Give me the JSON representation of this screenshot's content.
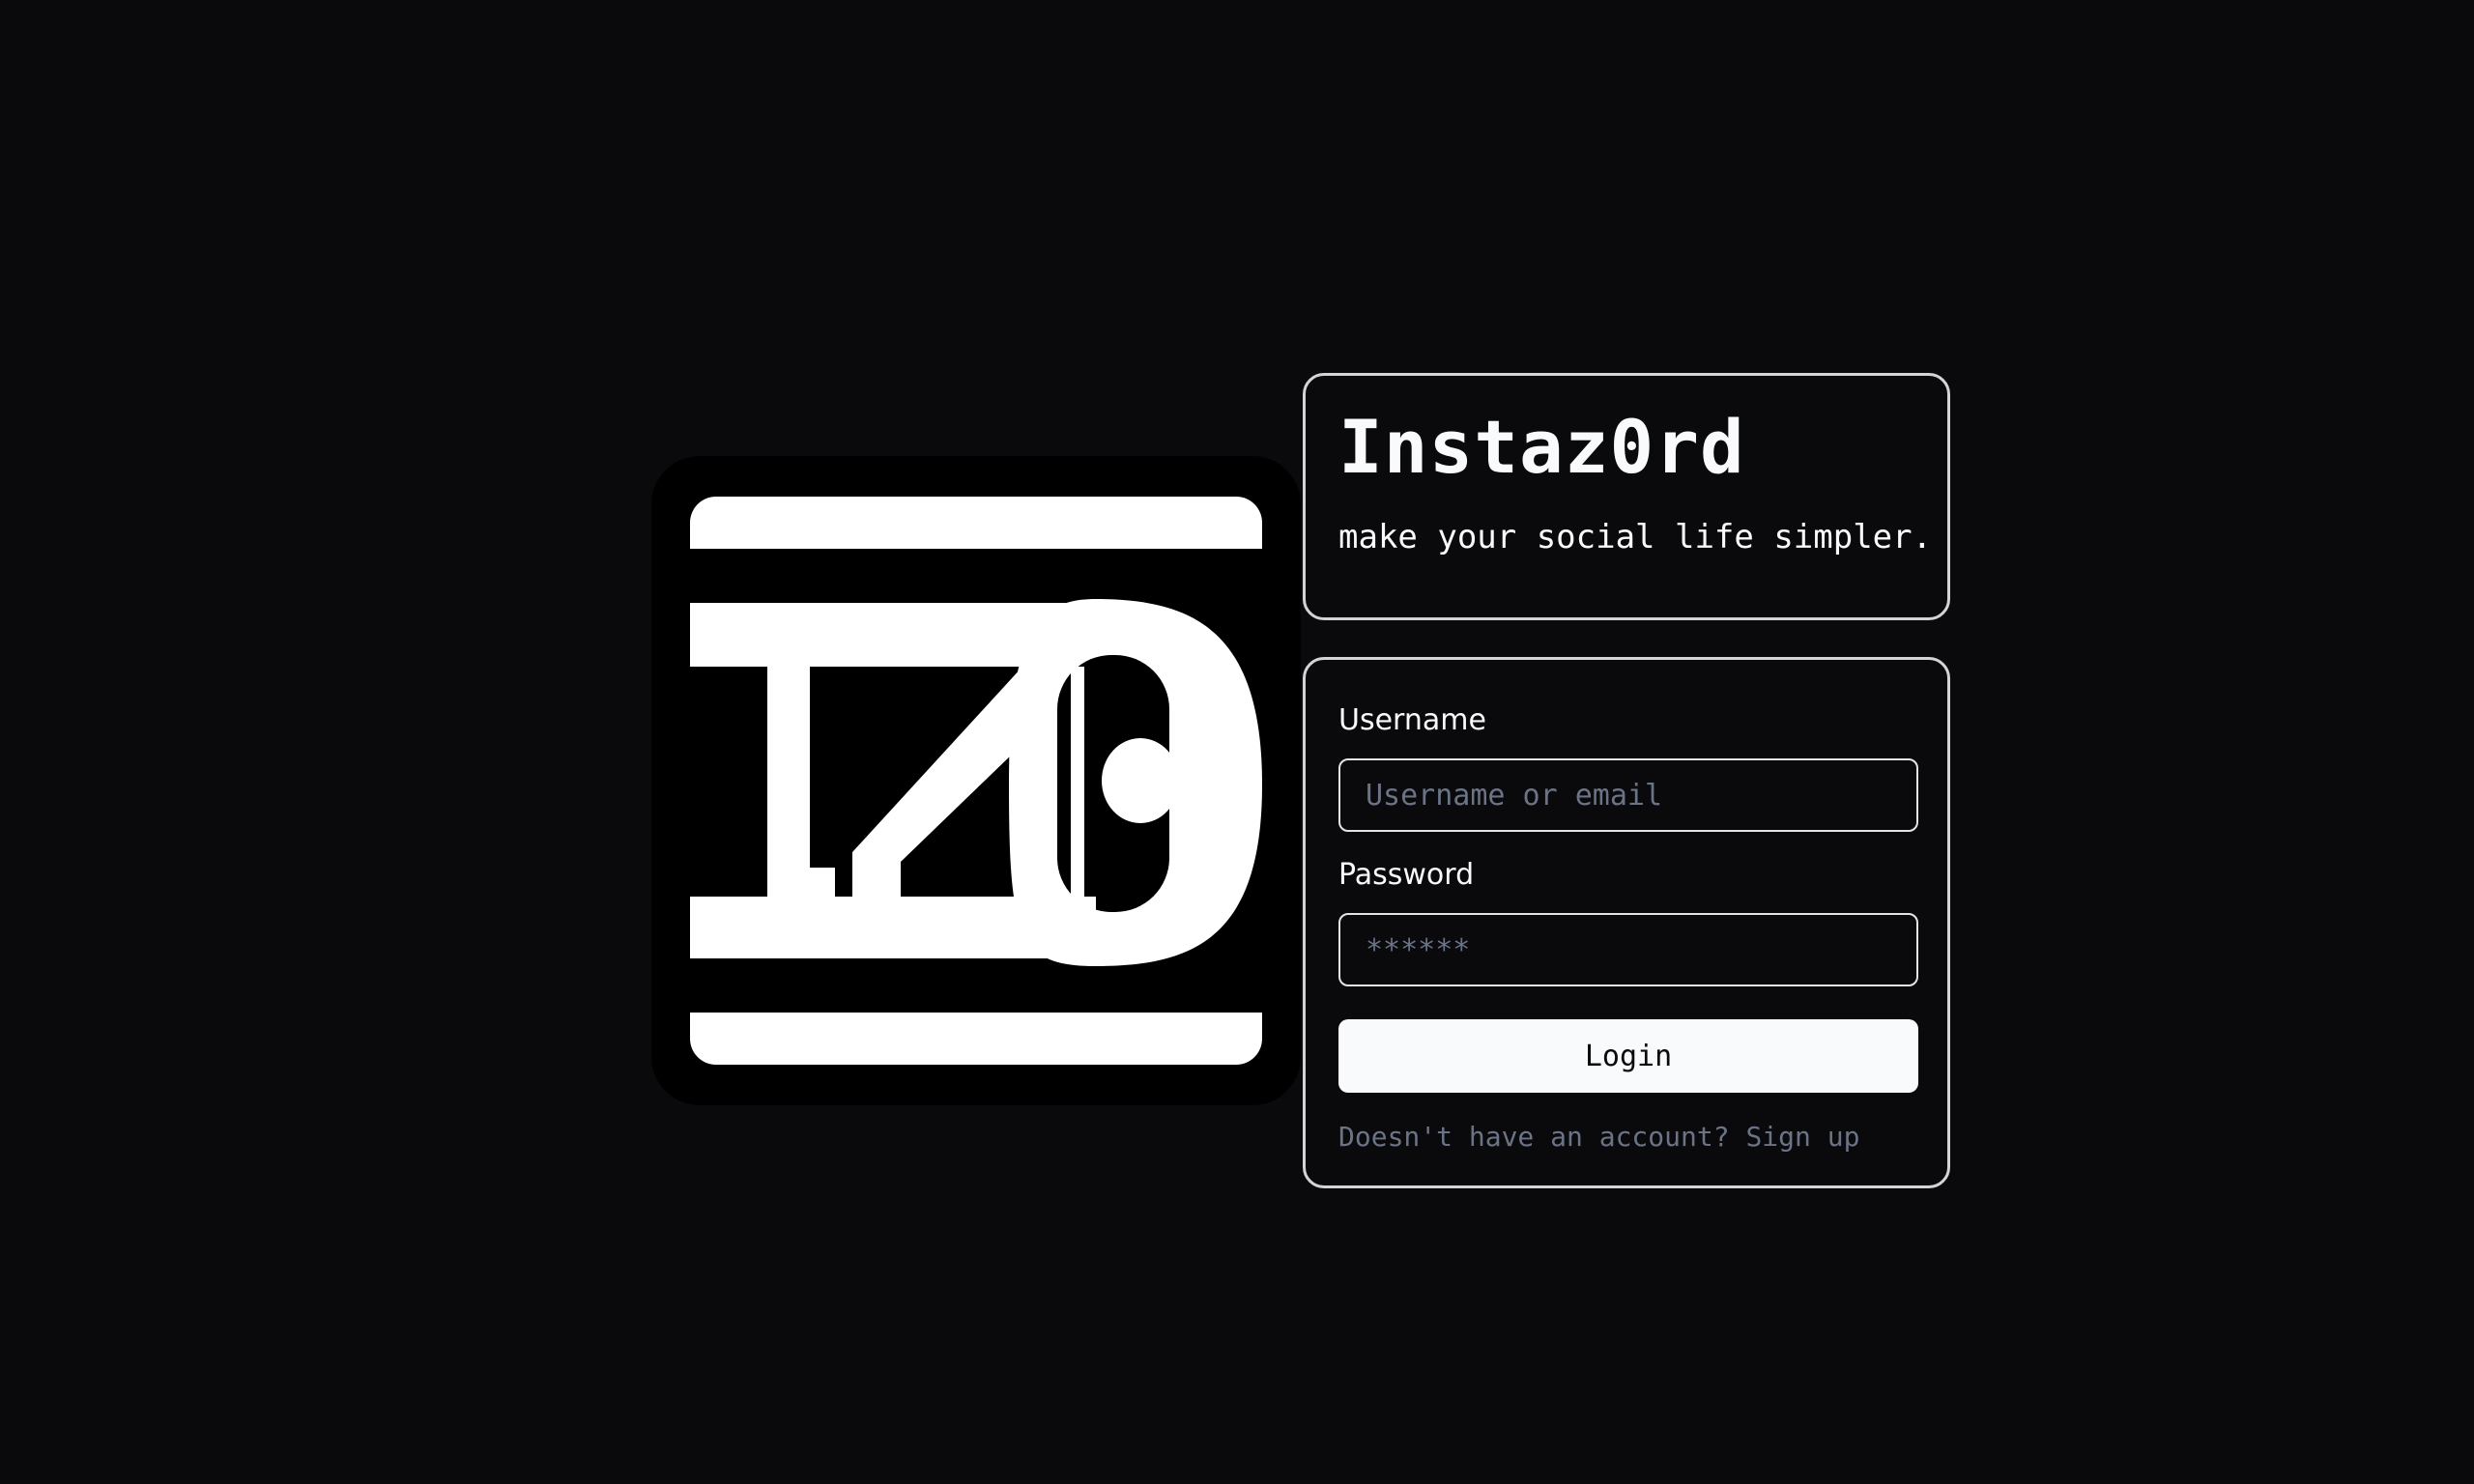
{
  "logo": {
    "name": "instaz0rd-logo",
    "alt": "IZ0"
  },
  "header": {
    "title": "Instaz0rd",
    "tagline": "make your social life simpler."
  },
  "login_form": {
    "username_label": "Username",
    "username_placeholder": "Username or email",
    "username_value": "",
    "password_label": "Password",
    "password_placeholder": "******",
    "password_value": "",
    "login_button_label": "Login",
    "signup_prompt": "Doesn't have an account?",
    "signup_link_label": "Sign up"
  },
  "colors": {
    "background": "#0a0a0c",
    "foreground": "#f8fafc",
    "border": "#d4d4d8",
    "muted_text": "#6b7386",
    "button_bg": "#f8fafc",
    "button_text": "#0a0a0c"
  }
}
